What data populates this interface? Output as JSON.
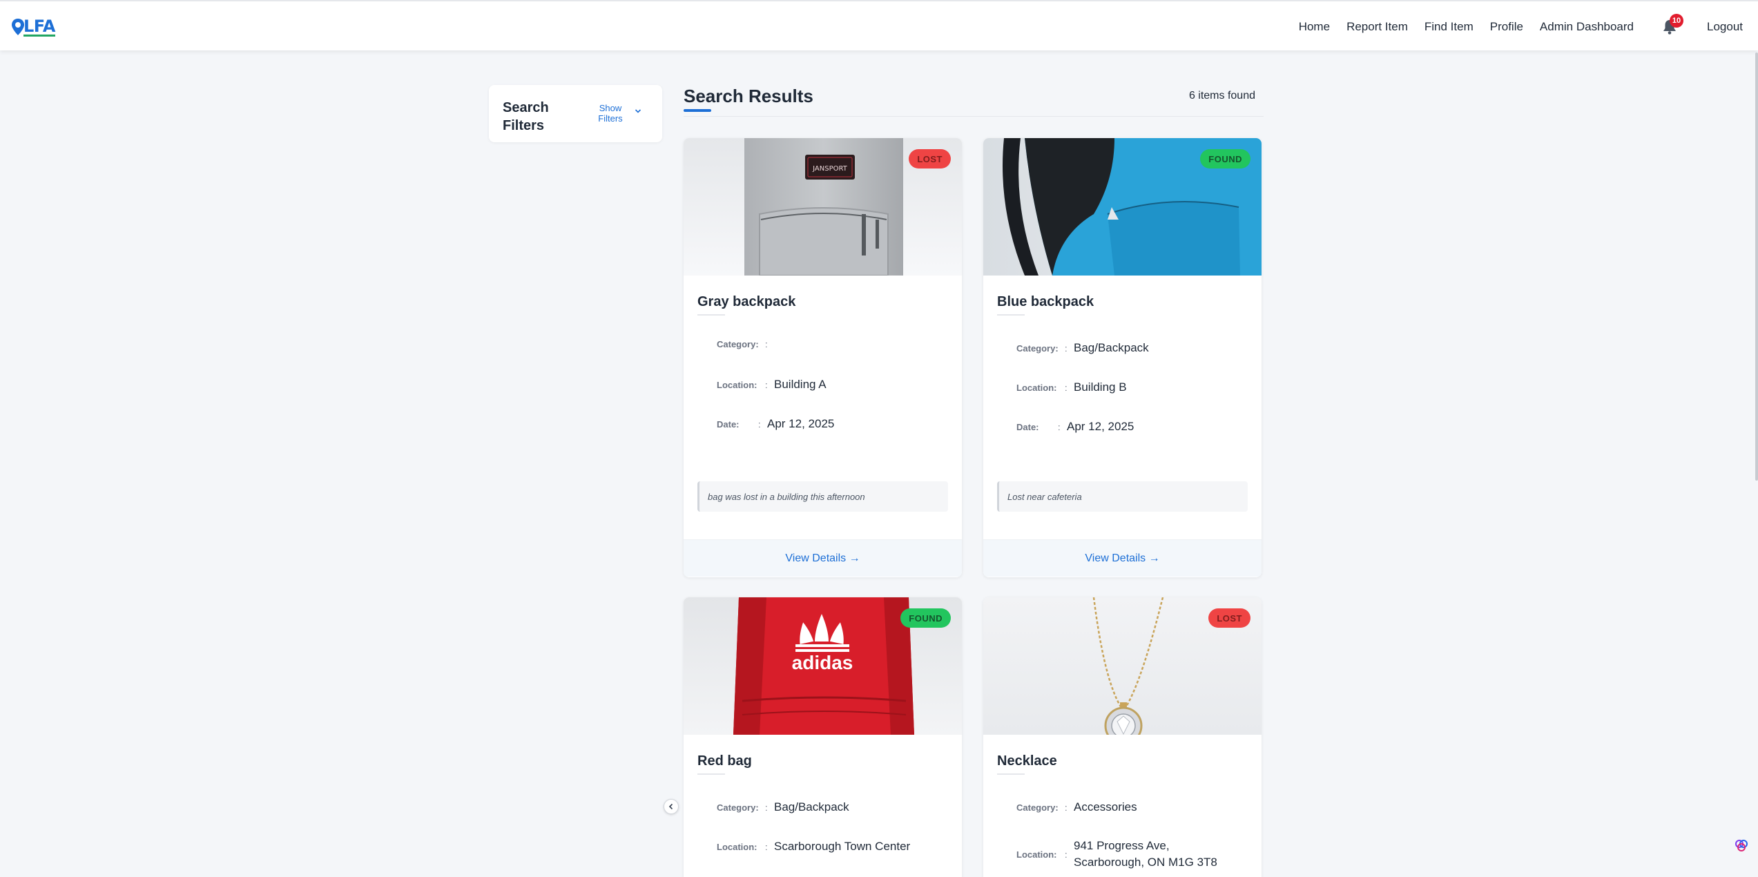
{
  "brand": {
    "logo_text": "LFA"
  },
  "nav": {
    "items": [
      "Home",
      "Report Item",
      "Find Item",
      "Profile",
      "Admin Dashboard"
    ],
    "notification_count": "10",
    "logout_label": "Logout"
  },
  "sidebar": {
    "title": "Search Filters",
    "toggle_label": "Show Filters"
  },
  "results": {
    "title": "Search Results",
    "count_text": "6 items found"
  },
  "labels": {
    "category": "Category:",
    "location": "Location:",
    "date": "Date:",
    "separator": ":",
    "view_details": "View Details →"
  },
  "items": [
    {
      "title": "Gray backpack",
      "status": "LOST",
      "category": "",
      "location": "Building A",
      "date": "Apr 12, 2025",
      "description": "bag was lost in a building this afternoon",
      "image": "gray-backpack",
      "image_text": "JANSPORT"
    },
    {
      "title": "Blue backpack",
      "status": "FOUND",
      "category": "Bag/Backpack",
      "location": "Building B",
      "date": "Apr 12, 2025",
      "description": "Lost near cafeteria",
      "image": "blue-backpack"
    },
    {
      "title": "Red bag",
      "status": "FOUND",
      "category": "Bag/Backpack",
      "location": "Scarborough Town Center",
      "image": "red-adidas-bag",
      "image_text": "adidas"
    },
    {
      "title": "Necklace",
      "status": "LOST",
      "category": "Accessories",
      "location": "941 Progress Ave, Scarborough, ON M1G 3T8",
      "image": "pendant-necklace"
    }
  ],
  "colors": {
    "accent": "#1d6fd6",
    "lost": "#ef4444",
    "found": "#22c55e",
    "background": "#f4f6f9"
  },
  "icons": [
    "map-pin-icon",
    "bell-icon",
    "chevron-down-icon",
    "chevron-left-icon",
    "assistant-icon"
  ]
}
